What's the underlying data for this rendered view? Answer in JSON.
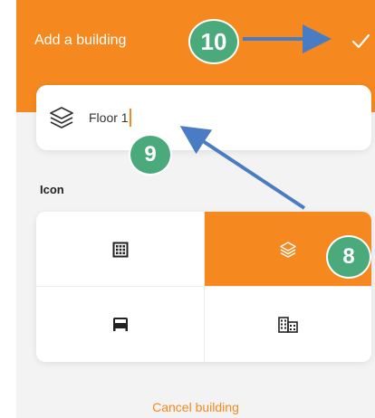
{
  "header": {
    "title": "Add a building",
    "confirm_icon": "check-icon",
    "background": "#f5891f"
  },
  "name_field": {
    "icon": "layers-icon",
    "value": "Floor 1"
  },
  "icon_section": {
    "label": "Icon",
    "selected_index": 1,
    "options": [
      {
        "icon": "building-grid-icon"
      },
      {
        "icon": "layers-icon"
      },
      {
        "icon": "bed-icon"
      },
      {
        "icon": "city-buildings-icon"
      }
    ]
  },
  "footer": {
    "cancel_label": "Cancel building"
  },
  "annotations": [
    {
      "number": "10"
    },
    {
      "number": "9"
    },
    {
      "number": "8"
    }
  ],
  "colors": {
    "accent": "#f5891f",
    "badge": "#4aaa7c",
    "arrow": "#4a7cc4"
  }
}
